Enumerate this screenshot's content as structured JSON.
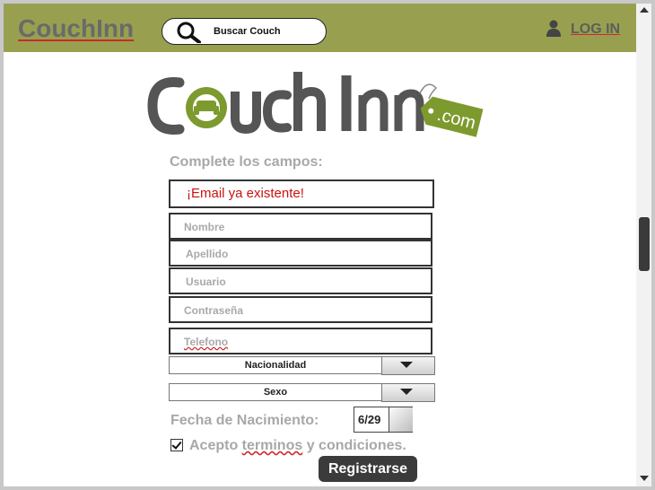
{
  "header": {
    "brand": "CouchInn",
    "search_placeholder": "Buscar Couch",
    "login_label": "LOG IN"
  },
  "logo": {
    "word": "Couch Inn",
    "tag": ".com"
  },
  "form": {
    "heading": "Complete los campos:",
    "error_message": "¡Email ya existente!",
    "fields": {
      "nombre": "Nombre",
      "apellido": "Apellido",
      "usuario": "Usuario",
      "contrasena": "Contraseña",
      "telefono": "Telefono"
    },
    "nacionalidad": "Nacionalidad",
    "sexo": "Sexo",
    "dob_label": "Fecha de Nacimiento:",
    "dob_value": "6/29",
    "terms_prefix": "Acepto ",
    "terms_word": "terminos",
    "terms_suffix": " y condiciones.",
    "terms_checked": true,
    "submit_label": "Registrarse"
  },
  "colors": {
    "topbar": "#98a050",
    "logo_green": "#7d9a2e",
    "error": "#cc1111"
  }
}
